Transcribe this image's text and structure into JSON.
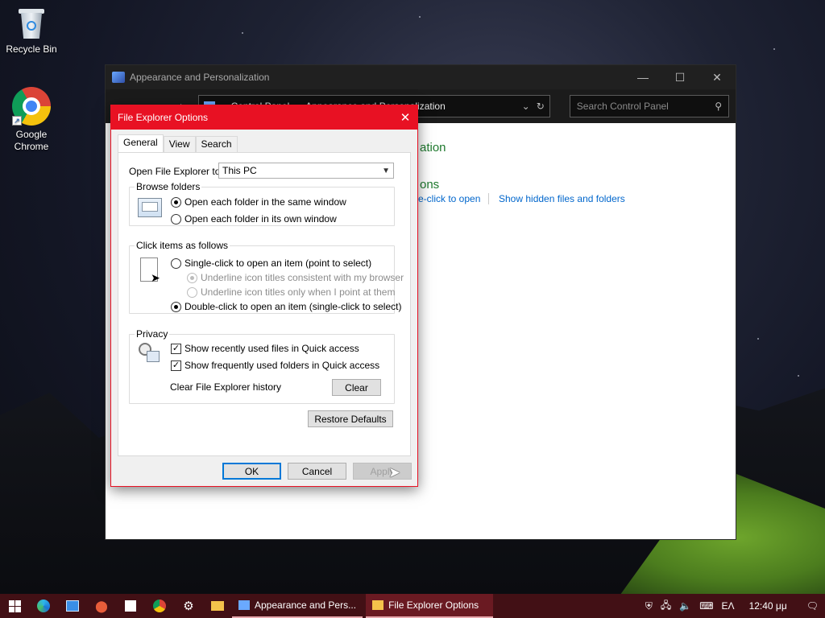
{
  "desktop": {
    "icons": [
      {
        "label": "Recycle Bin",
        "icon": "recycle-bin-icon"
      },
      {
        "label": "Google Chrome",
        "icon": "chrome-icon"
      }
    ]
  },
  "control_panel": {
    "title": "Appearance and Personalization",
    "breadcrumb": [
      "Control Panel",
      "Appearance and Personalization"
    ],
    "search_placeholder": "Search Control Panel",
    "heading_partial": "ation",
    "subheading_partial": "ons",
    "link_partial": "e-click to open",
    "link_hidden": "Show hidden files and folders"
  },
  "dialog": {
    "title": "File Explorer Options",
    "tabs": [
      "General",
      "View",
      "Search"
    ],
    "open_label": "Open File Explorer to:",
    "open_value": "This PC",
    "browse": {
      "legend": "Browse folders",
      "same_window": "Open each folder in the same window",
      "own_window": "Open each folder in its own window"
    },
    "click": {
      "legend": "Click items as follows",
      "single": "Single-click to open an item (point to select)",
      "underline_browser": "Underline icon titles consistent with my browser",
      "underline_point": "Underline icon titles only when I point at them",
      "double": "Double-click to open an item (single-click to select)"
    },
    "privacy": {
      "legend": "Privacy",
      "recent_files": "Show recently used files in Quick access",
      "frequent_folders": "Show frequently used folders in Quick access",
      "clear_label": "Clear File Explorer history",
      "clear_button": "Clear"
    },
    "restore_defaults": "Restore Defaults",
    "ok": "OK",
    "cancel": "Cancel",
    "apply": "Apply"
  },
  "taskbar": {
    "apps": [
      {
        "label": "Appearance and Pers..."
      },
      {
        "label": "File Explorer Options"
      }
    ],
    "language": "ΕΛ",
    "time": "12:40 μμ"
  },
  "colors": {
    "dialog_accent": "#e81123",
    "taskbar": "#421015",
    "link": "#0066cc",
    "cp_heading": "#1f7a2e"
  }
}
